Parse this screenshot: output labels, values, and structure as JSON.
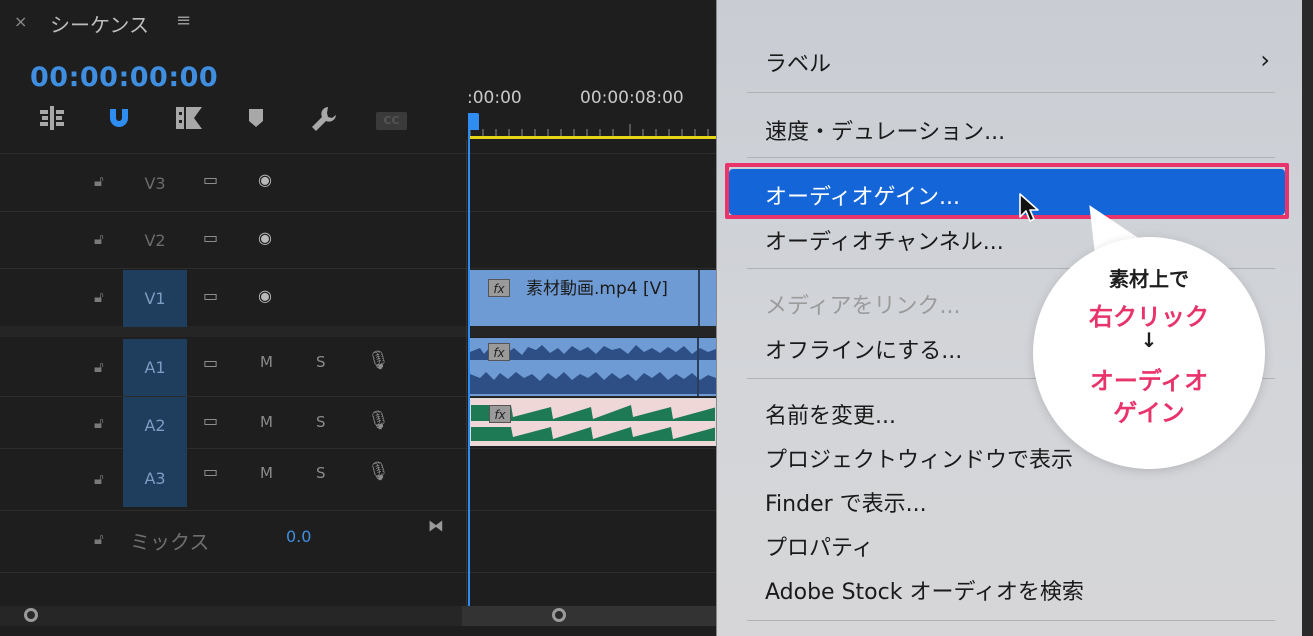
{
  "header": {
    "close": "×",
    "title": "シーケンス",
    "menu": "≡"
  },
  "timecode": "00:00:00:00",
  "toolbar": {
    "cc_label": "CC"
  },
  "ruler": {
    "labels": [
      ":00:00",
      "00:00:08:00"
    ]
  },
  "tracks": [
    {
      "id": "V3",
      "kind": "video",
      "active": false
    },
    {
      "id": "V2",
      "kind": "video",
      "active": false
    },
    {
      "id": "V1",
      "kind": "video",
      "active": true
    },
    {
      "id": "A1",
      "kind": "audio",
      "active": true,
      "m": "M",
      "s": "S"
    },
    {
      "id": "A2",
      "kind": "audio",
      "active": true,
      "m": "M",
      "s": "S"
    },
    {
      "id": "A3",
      "kind": "audio",
      "active": true,
      "m": "M",
      "s": "S"
    }
  ],
  "clips": {
    "video_name": "素材動画.mp4 [V]",
    "fx": "fx"
  },
  "mix": {
    "label": "ミックス",
    "value": "0.0"
  },
  "menu": {
    "items": [
      {
        "label": "ラベル",
        "submenu": true,
        "disabled": false
      },
      {
        "label": "速度・デュレーション...",
        "disabled": false
      },
      {
        "label": "オーディオゲイン...",
        "highlighted": true,
        "disabled": false
      },
      {
        "label": "オーディオチャンネル...",
        "disabled": false
      },
      {
        "label": "メディアをリンク...",
        "disabled": true
      },
      {
        "label": "オフラインにする...",
        "disabled": false
      },
      {
        "label": "名前を変更...",
        "disabled": false
      },
      {
        "label": "プロジェクトウィンドウで表示",
        "disabled": false
      },
      {
        "label": "Finder で表示...",
        "disabled": false
      },
      {
        "label": "プロパティ",
        "disabled": false
      },
      {
        "label": "Adobe Stock オーディオを検索",
        "disabled": false
      }
    ],
    "submenu_chevron": "›"
  },
  "callout": {
    "line1": "素材上で",
    "line2": "右クリック",
    "arrow": "↓",
    "line3": "オーディオ",
    "line4": "ゲイン"
  },
  "colors": {
    "accent": "#2f8cf0",
    "highlight": "#1466d8",
    "callout_pink": "#e8336b",
    "timecode": "#3f8ee0"
  }
}
